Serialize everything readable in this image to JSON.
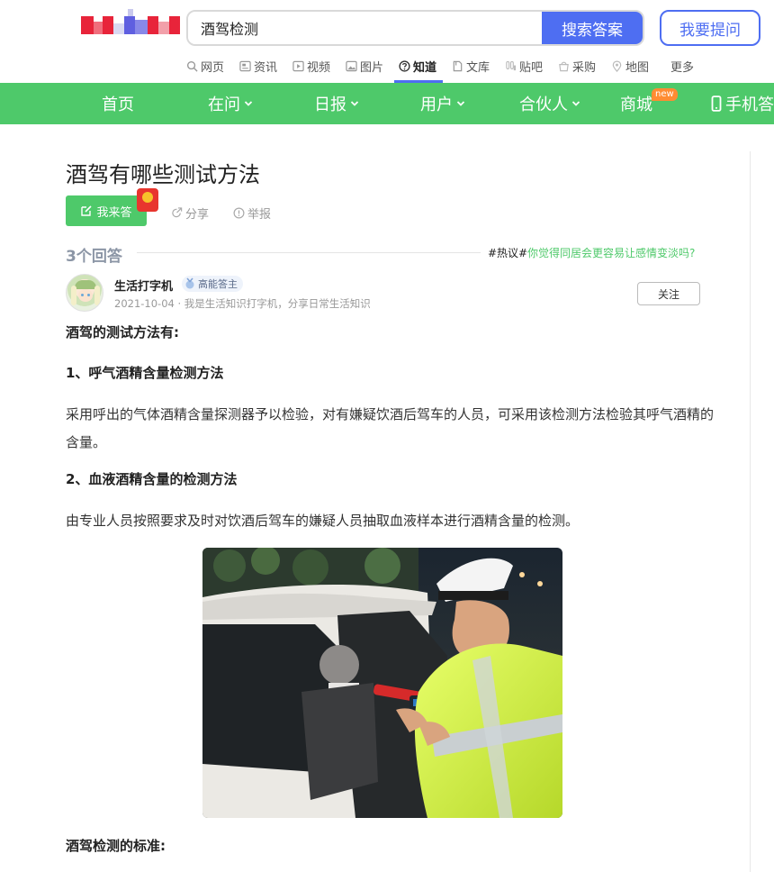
{
  "search": {
    "value": "酒驾检测",
    "button": "搜索答案",
    "ask": "我要提问"
  },
  "subnav": [
    {
      "label": "网页",
      "icon": "search-icon"
    },
    {
      "label": "资讯",
      "icon": "news-icon"
    },
    {
      "label": "视频",
      "icon": "video-icon"
    },
    {
      "label": "图片",
      "icon": "image-icon"
    },
    {
      "label": "知道",
      "icon": "question-icon",
      "active": true
    },
    {
      "label": "文库",
      "icon": "doc-icon"
    },
    {
      "label": "贴吧",
      "icon": "tieba-icon"
    },
    {
      "label": "采购",
      "icon": "shop-icon"
    },
    {
      "label": "地图",
      "icon": "map-icon"
    },
    {
      "label": "更多",
      "icon": ""
    }
  ],
  "greennav": [
    {
      "label": "首页"
    },
    {
      "label": "在问",
      "dropdown": true
    },
    {
      "label": "日报",
      "dropdown": true
    },
    {
      "label": "用户",
      "dropdown": true
    },
    {
      "label": "合伙人",
      "dropdown": true
    },
    {
      "label": "商城",
      "badge": "new"
    },
    {
      "label": "手机答",
      "icon": "phone-icon"
    }
  ],
  "colors": {
    "green": "#4ec96a",
    "blue": "#4e6ef2",
    "red": "#e8352e"
  },
  "question": {
    "title": "酒驾有哪些测试方法",
    "answer_button": "我来答",
    "share": "分享",
    "report": "举报"
  },
  "answers": {
    "count": "3个回答",
    "hot_tag": "#热议#",
    "hot_link": "你觉得同居会更容易让感情变淡吗?"
  },
  "answer": {
    "user": "生活打字机",
    "level": "高能答主",
    "meta": "2021-10-04 · 我是生活知识打字机，分享日常生活知识",
    "follow": "关注",
    "paragraphs": [
      "酒驾的测试方法有:",
      "1、呼气酒精含量检测方法",
      "采用呼出的气体酒精含量探测器予以检验，对有嫌疑饮酒后驾车的人员，可采用该检测方法检验其呼气酒精的含量。",
      "2、血液酒精含量的检测方法",
      "由专业人员按照要求及时对饮酒后驾车的嫌疑人员抽取血液样本进行酒精含量的检测。",
      "酒驾检测的标准:"
    ]
  }
}
